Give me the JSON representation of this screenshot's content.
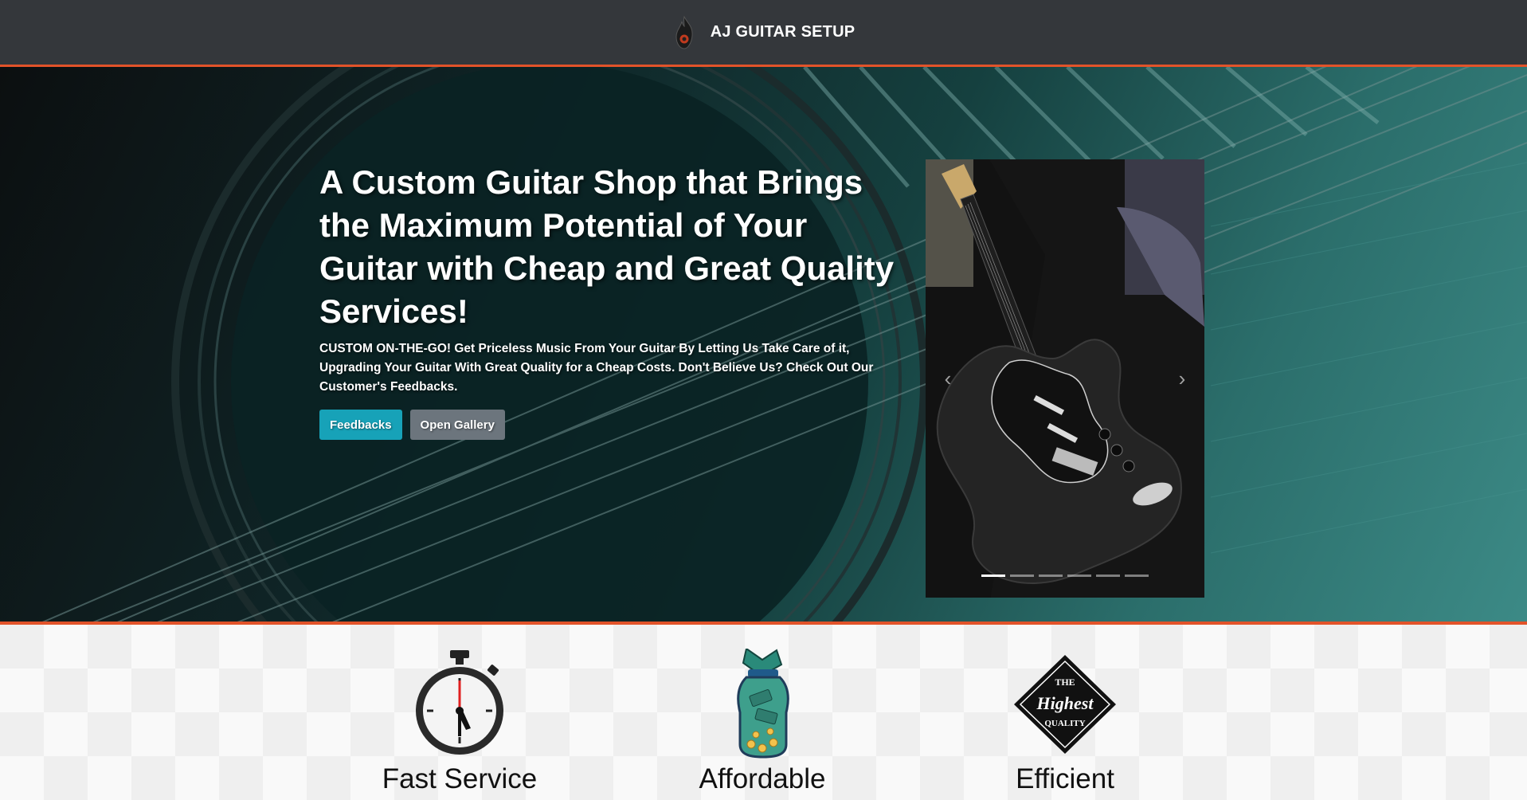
{
  "header": {
    "brand_name": "AJ GUITAR SETUP",
    "icon": "flame-logo-icon"
  },
  "hero": {
    "title": "A Custom Guitar Shop that Brings the Maximum Potential of Your Guitar with Cheap and Great Quality Services!",
    "subtitle": "CUSTOM ON-THE-GO! Get Priceless Music From Your Guitar By Letting Us Take Care of it, Upgrading Your Guitar With Great Quality for a Cheap Costs. Don't Believe Us? Check Out Our Customer's Feedbacks.",
    "buttons": {
      "feedbacks": "Feedbacks",
      "gallery": "Open Gallery"
    }
  },
  "carousel": {
    "prev_icon": "chevron-left-icon",
    "next_icon": "chevron-right-icon",
    "slide_count": 6,
    "active_index": 0
  },
  "features": [
    {
      "label": "Fast Service",
      "icon": "stopwatch-icon"
    },
    {
      "label": "Affordable",
      "icon": "money-jar-icon"
    },
    {
      "label": "Efficient",
      "icon": "highest-quality-badge-icon"
    }
  ],
  "badge_text": {
    "line1": "THE",
    "line2": "Highest",
    "line3": "QUALITY"
  },
  "colors": {
    "header_bg": "#34373b",
    "accent_orange": "#e2532a",
    "primary_button": "#17a2b8",
    "secondary_button": "#6c757d",
    "hero_teal": "#2b6e6b"
  }
}
